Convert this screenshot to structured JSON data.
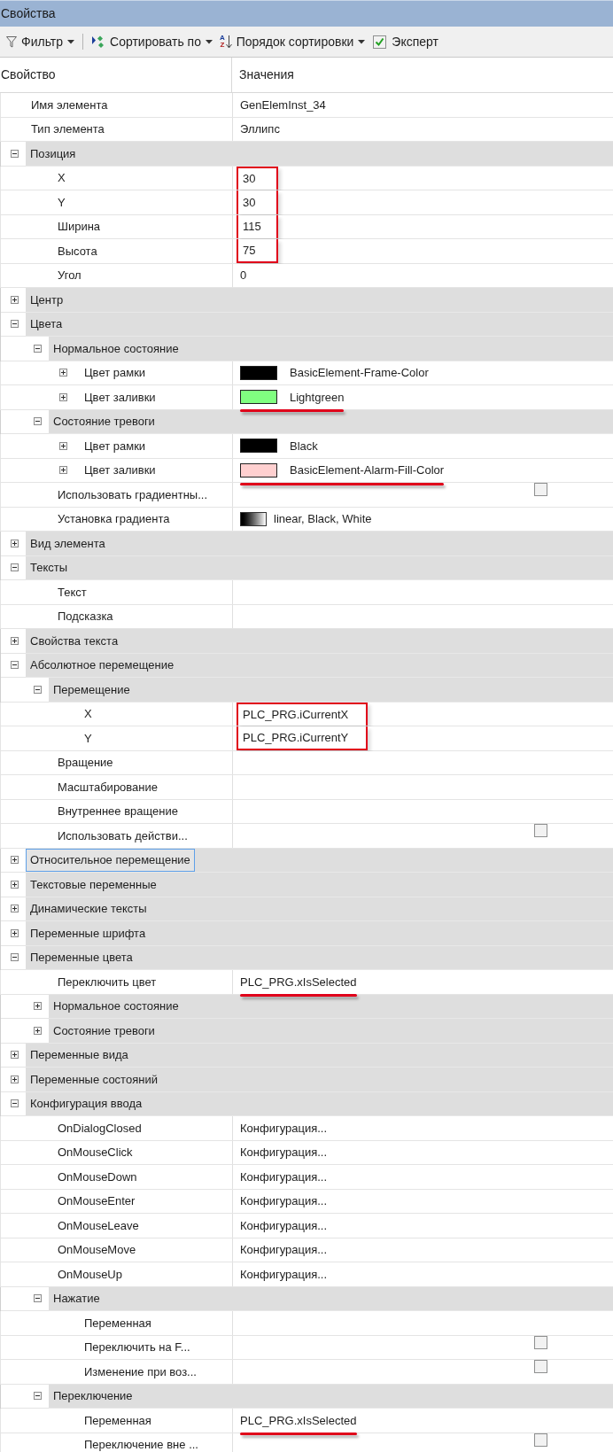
{
  "window": {
    "title": "Свойства"
  },
  "toolbar": [
    {
      "kind": "dropdown",
      "label": "Фильтр"
    },
    {
      "kind": "dropdown",
      "label": "Сортировать по"
    },
    {
      "kind": "dropdown",
      "icon_letters": [
        "A",
        "Z"
      ],
      "label": "Порядок сортировки"
    },
    {
      "kind": "checkbox",
      "label": "Эксперт",
      "checked": true
    }
  ],
  "columns": [
    "Свойство",
    "Значения"
  ],
  "rows": [
    {
      "kind": "property",
      "label": "Имя элемента",
      "selected": false,
      "value": {
        "kind": "text",
        "text": "GenElemInst_34"
      }
    },
    {
      "kind": "property",
      "label": "Тип элемента",
      "selected": false,
      "value": {
        "kind": "text",
        "text": "Эллипс"
      }
    },
    {
      "kind": "group",
      "label": "Позиция",
      "expanded": true,
      "selected": false,
      "children": [
        {
          "kind": "property",
          "label": "X",
          "selected": false,
          "value": {
            "kind": "text",
            "text": "30"
          },
          "boxed": true
        },
        {
          "kind": "property",
          "label": "Y",
          "selected": false,
          "value": {
            "kind": "text",
            "text": "30"
          },
          "boxed": true
        },
        {
          "kind": "property",
          "label": "Ширина",
          "selected": false,
          "value": {
            "kind": "text",
            "text": "115"
          },
          "boxed": true
        },
        {
          "kind": "property",
          "label": "Высота",
          "selected": false,
          "value": {
            "kind": "text",
            "text": "75"
          },
          "boxed": true
        },
        {
          "kind": "property",
          "label": "Угол",
          "selected": false,
          "value": {
            "kind": "text",
            "text": "0"
          }
        }
      ]
    },
    {
      "kind": "group",
      "label": "Центр",
      "expanded": false,
      "selected": false
    },
    {
      "kind": "group",
      "label": "Цвета",
      "expanded": true,
      "selected": false,
      "children": [
        {
          "kind": "group",
          "label": "Нормальное состояние",
          "expanded": true,
          "selected": false,
          "children": [
            {
              "kind": "property",
              "label": "Цвет рамки",
              "expanded": false,
              "selected": false,
              "value": {
                "kind": "color",
                "color": "#000000",
                "text": "BasicElement-Frame-Color"
              }
            },
            {
              "kind": "property",
              "label": "Цвет заливки",
              "expanded": false,
              "selected": false,
              "value": {
                "kind": "color",
                "color": "#80ff80",
                "text": "Lightgreen"
              },
              "underlined": true
            }
          ]
        },
        {
          "kind": "group",
          "label": "Состояние тревоги",
          "expanded": true,
          "selected": false,
          "children": [
            {
              "kind": "property",
              "label": "Цвет рамки",
              "expanded": false,
              "selected": false,
              "value": {
                "kind": "color",
                "color": "#000000",
                "text": "Black"
              }
            },
            {
              "kind": "property",
              "label": "Цвет заливки",
              "expanded": false,
              "selected": false,
              "value": {
                "kind": "color",
                "color": "#ffd0d0",
                "text": "BasicElement-Alarm-Fill-Color"
              },
              "underlined": true
            }
          ]
        },
        {
          "kind": "property",
          "label": "Использовать градиентны...",
          "selected": false,
          "value": {
            "kind": "checkbox",
            "checked": false
          }
        },
        {
          "kind": "property",
          "label": "Установка градиента",
          "selected": false,
          "value": {
            "kind": "gradient",
            "text": "linear, Black, White"
          }
        }
      ]
    },
    {
      "kind": "group",
      "label": "Вид элемента",
      "expanded": false,
      "selected": false
    },
    {
      "kind": "group",
      "label": "Тексты",
      "expanded": true,
      "selected": false,
      "children": [
        {
          "kind": "property",
          "label": "Текст",
          "selected": false
        },
        {
          "kind": "property",
          "label": "Подсказка",
          "selected": false
        }
      ]
    },
    {
      "kind": "group",
      "label": "Свойства текста",
      "expanded": false,
      "selected": false
    },
    {
      "kind": "group",
      "label": "Абсолютное перемещение",
      "expanded": true,
      "selected": false,
      "children": [
        {
          "kind": "group",
          "label": "Перемещение",
          "expanded": true,
          "selected": false,
          "children": [
            {
              "kind": "property",
              "label": "X",
              "selected": false,
              "value": {
                "kind": "text",
                "text": "PLC_PRG.iCurrentX"
              },
              "boxed": true
            },
            {
              "kind": "property",
              "label": "Y",
              "selected": false,
              "value": {
                "kind": "text",
                "text": "PLC_PRG.iCurrentY"
              },
              "boxed": true
            }
          ]
        },
        {
          "kind": "property",
          "label": "Вращение",
          "selected": false
        },
        {
          "kind": "property",
          "label": "Масштабирование",
          "selected": false
        },
        {
          "kind": "property",
          "label": "Внутреннее вращение",
          "selected": false
        },
        {
          "kind": "property",
          "label": "Использовать действи...",
          "selected": false,
          "value": {
            "kind": "checkbox",
            "checked": false
          }
        }
      ]
    },
    {
      "kind": "group",
      "label": "Относительное перемещение",
      "expanded": false,
      "selected": true
    },
    {
      "kind": "group",
      "label": "Текстовые переменные",
      "expanded": false,
      "selected": false
    },
    {
      "kind": "group",
      "label": "Динамические тексты",
      "expanded": false,
      "selected": false
    },
    {
      "kind": "group",
      "label": "Переменные шрифта",
      "expanded": false,
      "selected": false
    },
    {
      "kind": "group",
      "label": "Переменные цвета",
      "expanded": true,
      "selected": false,
      "children": [
        {
          "kind": "property",
          "label": "Переключить цвет",
          "selected": false,
          "value": {
            "kind": "text",
            "text": "PLC_PRG.xIsSelected"
          },
          "underlined": true
        },
        {
          "kind": "group",
          "label": "Нормальное состояние",
          "expanded": false,
          "selected": false
        },
        {
          "kind": "group",
          "label": "Состояние тревоги",
          "expanded": false,
          "selected": false
        }
      ]
    },
    {
      "kind": "group",
      "label": "Переменные вида",
      "expanded": false,
      "selected": false
    },
    {
      "kind": "group",
      "label": "Переменные состояний",
      "expanded": false,
      "selected": false
    },
    {
      "kind": "group",
      "label": "Конфигурация ввода",
      "expanded": true,
      "selected": false,
      "children": [
        {
          "kind": "property",
          "label": "OnDialogClosed",
          "selected": false,
          "value": {
            "kind": "text",
            "text": "Конфигурация..."
          }
        },
        {
          "kind": "property",
          "label": "OnMouseClick",
          "selected": false,
          "value": {
            "kind": "text",
            "text": "Конфигурация..."
          }
        },
        {
          "kind": "property",
          "label": "OnMouseDown",
          "selected": false,
          "value": {
            "kind": "text",
            "text": "Конфигурация..."
          }
        },
        {
          "kind": "property",
          "label": "OnMouseEnter",
          "selected": false,
          "value": {
            "kind": "text",
            "text": "Конфигурация..."
          }
        },
        {
          "kind": "property",
          "label": "OnMouseLeave",
          "selected": false,
          "value": {
            "kind": "text",
            "text": "Конфигурация..."
          }
        },
        {
          "kind": "property",
          "label": "OnMouseMove",
          "selected": false,
          "value": {
            "kind": "text",
            "text": "Конфигурация..."
          }
        },
        {
          "kind": "property",
          "label": "OnMouseUp",
          "selected": false,
          "value": {
            "kind": "text",
            "text": "Конфигурация..."
          }
        },
        {
          "kind": "group",
          "label": "Нажатие",
          "expanded": true,
          "selected": false,
          "children": [
            {
              "kind": "property",
              "label": "Переменная",
              "selected": false
            },
            {
              "kind": "property",
              "label": "Переключить на F...",
              "selected": false,
              "value": {
                "kind": "checkbox",
                "checked": false
              }
            },
            {
              "kind": "property",
              "label": "Изменение при воз...",
              "selected": false,
              "value": {
                "kind": "checkbox",
                "checked": false
              }
            }
          ]
        },
        {
          "kind": "group",
          "label": "Переключение",
          "expanded": true,
          "selected": false,
          "children": [
            {
              "kind": "property",
              "label": "Переменная",
              "selected": false,
              "value": {
                "kind": "text",
                "text": "PLC_PRG.xIsSelected"
              },
              "underlined": true
            },
            {
              "kind": "property",
              "label": "Переключение вне ...",
              "selected": false,
              "value": {
                "kind": "checkbox",
                "checked": false
              }
            }
          ]
        }
      ]
    }
  ]
}
